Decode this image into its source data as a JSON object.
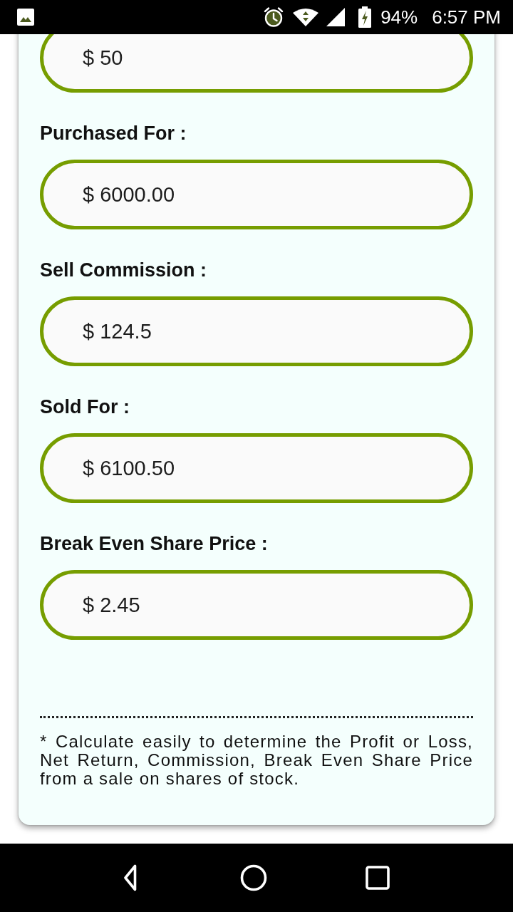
{
  "status_bar": {
    "battery": "94%",
    "time": "6:57 PM"
  },
  "fields": [
    {
      "value": "$ 50"
    },
    {
      "label": "Purchased For :",
      "value": "$ 6000.00"
    },
    {
      "label": "Sell Commission :",
      "value": "$ 124.5"
    },
    {
      "label": "Sold For :",
      "value": "$ 6100.50"
    },
    {
      "label": "Break Even Share Price :",
      "value": "$ 2.45"
    }
  ],
  "note": "* Calculate easily to determine the Profit or Loss, Net Return, Commission, Break Even Share Price from a sale on shares of stock."
}
